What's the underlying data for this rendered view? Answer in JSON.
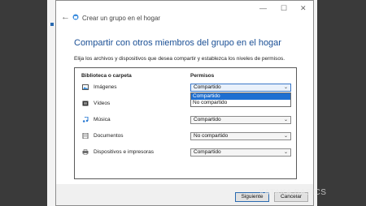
{
  "window": {
    "title": "Crear un grupo en el hogar",
    "minimize_glyph": "—",
    "maximize_glyph": "☐",
    "close_glyph": "✕"
  },
  "heading": "Compartir con otros miembros del grupo en el hogar",
  "instruction": "Elija los archivos y dispositivos que desea compartir y establezca los niveles de permisos.",
  "table": {
    "col_library": "Biblioteca o carpeta",
    "col_permissions": "Permisos",
    "rows": [
      {
        "label": "Imágenes",
        "icon": "pictures-icon",
        "permission": "Compartido"
      },
      {
        "label": "Vídeos",
        "icon": "videos-icon",
        "permission": ""
      },
      {
        "label": "Música",
        "icon": "music-icon",
        "permission": "Compartido"
      },
      {
        "label": "Documentos",
        "icon": "documents-icon",
        "permission": "No compartido"
      },
      {
        "label": "Dispositivos e impresoras",
        "icon": "printer-icon",
        "permission": "Compartido"
      }
    ]
  },
  "dropdown": {
    "options": [
      "Compartido",
      "No compartido"
    ],
    "selected": "Compartido"
  },
  "buttons": {
    "next": "Siguiente",
    "cancel": "Cancelar"
  },
  "watermark": "XATAKA BASICS",
  "colors": {
    "accent": "#1e6fd1",
    "heading": "#1a4f95"
  }
}
